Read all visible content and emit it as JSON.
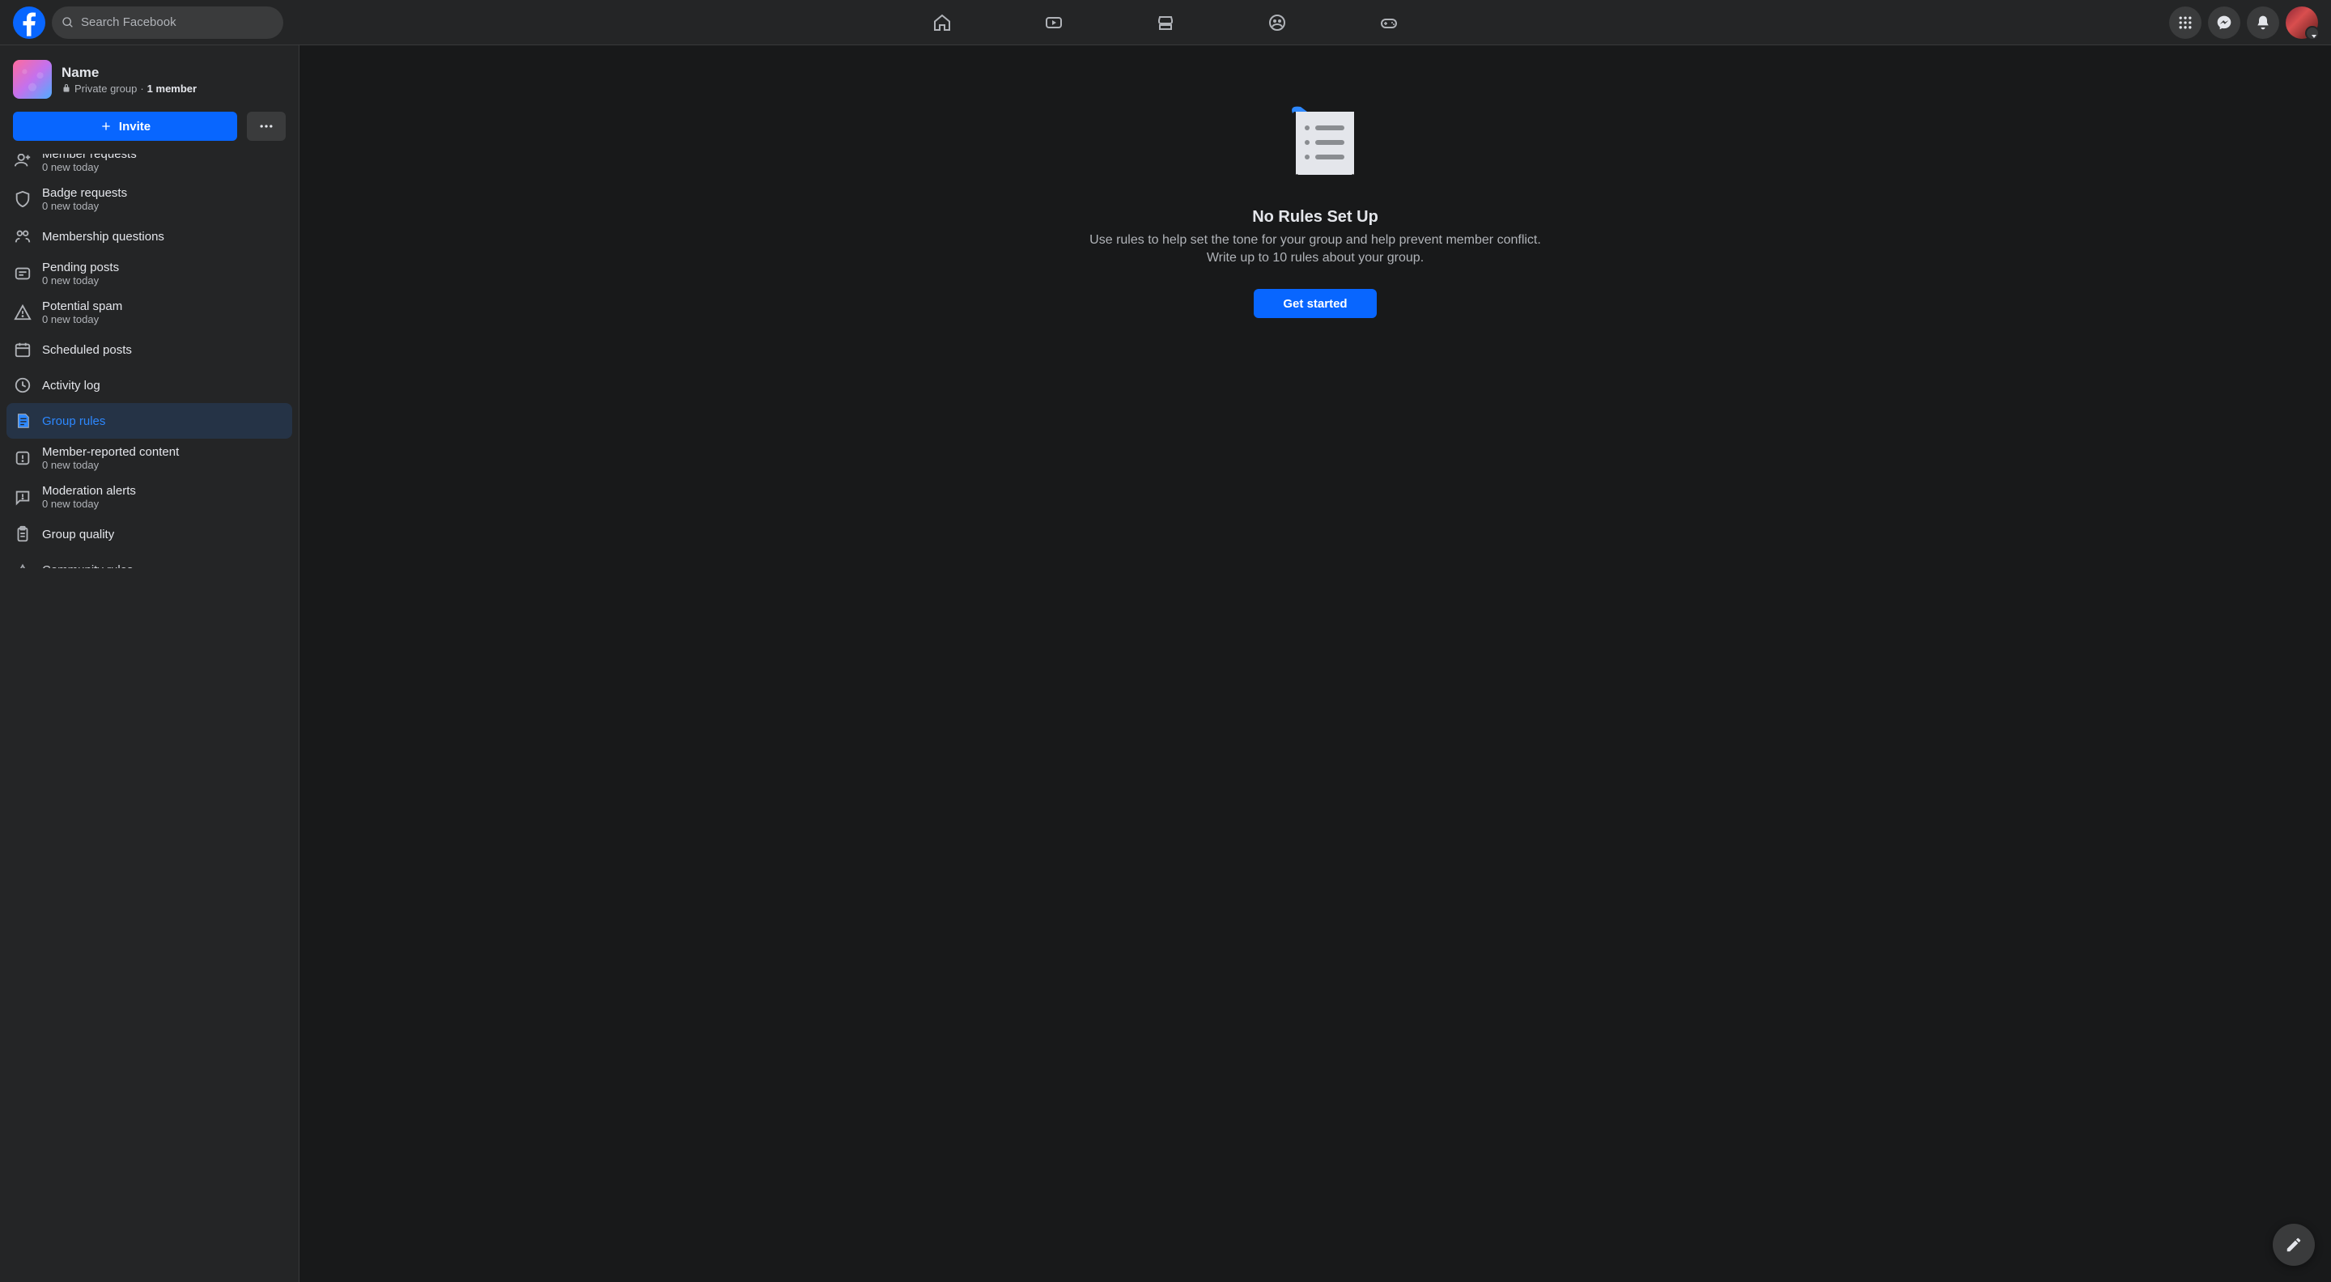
{
  "search": {
    "placeholder": "Search Facebook"
  },
  "group": {
    "name": "Name",
    "privacy": "Private group",
    "separator": " · ",
    "members": "1 member"
  },
  "actions": {
    "invite": "Invite"
  },
  "sidebar": {
    "items": [
      {
        "label": "Member requests",
        "sub": "0 new today",
        "active": false,
        "icon": "person-add",
        "partial": true
      },
      {
        "label": "Badge requests",
        "sub": "0 new today",
        "active": false,
        "icon": "shield"
      },
      {
        "label": "Membership questions",
        "sub": "",
        "active": false,
        "icon": "questions"
      },
      {
        "label": "Pending posts",
        "sub": "0 new today",
        "active": false,
        "icon": "pending"
      },
      {
        "label": "Potential spam",
        "sub": "0 new today",
        "active": false,
        "icon": "warning"
      },
      {
        "label": "Scheduled posts",
        "sub": "",
        "active": false,
        "icon": "calendar"
      },
      {
        "label": "Activity log",
        "sub": "",
        "active": false,
        "icon": "clock"
      },
      {
        "label": "Group rules",
        "sub": "",
        "active": true,
        "icon": "rules"
      },
      {
        "label": "Member-reported content",
        "sub": "0 new today",
        "active": false,
        "icon": "report"
      },
      {
        "label": "Moderation alerts",
        "sub": "0 new today",
        "active": false,
        "icon": "alert"
      },
      {
        "label": "Group quality",
        "sub": "",
        "active": false,
        "icon": "clipboard"
      },
      {
        "label": "Community rules",
        "sub": "",
        "active": false,
        "icon": "community",
        "lastcut": true
      }
    ]
  },
  "content": {
    "title": "No Rules Set Up",
    "desc": "Use rules to help set the tone for your group and help prevent member conflict. Write up to 10 rules about your group.",
    "cta": "Get started"
  },
  "colors": {
    "accent": "#0866ff",
    "accent_light": "#2d88ff"
  }
}
